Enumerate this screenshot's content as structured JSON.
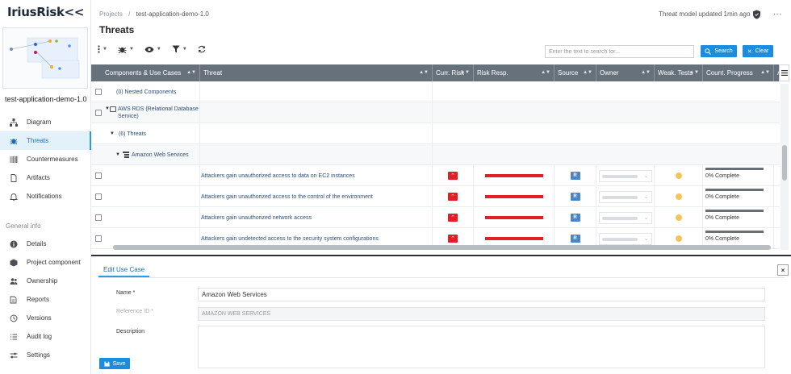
{
  "app": {
    "logo_text": "IriusRisk"
  },
  "project": {
    "name": "test-application-demo-1.0"
  },
  "breadcrumb": {
    "root": "Projects",
    "separator": "/",
    "current": "test-application-demo-1.0"
  },
  "header": {
    "status": "Threat model updated 1min ago",
    "more": "...",
    "page_title": "Threats"
  },
  "sidebar": {
    "items": [
      {
        "label": "Diagram",
        "icon": "sitemap-icon"
      },
      {
        "label": "Threats",
        "icon": "bug-icon",
        "active": true
      },
      {
        "label": "Countermeasures",
        "icon": "barcode-icon"
      },
      {
        "label": "Artifacts",
        "icon": "file-icon"
      },
      {
        "label": "Notifications",
        "icon": "bell-icon"
      }
    ],
    "section_label": "General info",
    "general_items": [
      {
        "label": "Details",
        "icon": "info-icon"
      },
      {
        "label": "Project component",
        "icon": "cube-icon"
      },
      {
        "label": "Ownership",
        "icon": "users-icon"
      },
      {
        "label": "Reports",
        "icon": "reports-icon"
      },
      {
        "label": "Versions",
        "icon": "history-icon"
      },
      {
        "label": "Audit log",
        "icon": "list-icon"
      },
      {
        "label": "Settings",
        "icon": "sliders-icon"
      }
    ]
  },
  "search": {
    "placeholder": "Enter the text to search for...",
    "search_label": "Search",
    "clear_label": "Clear"
  },
  "table": {
    "columns": [
      "Components & Use Cases",
      "Threat",
      "Curr. Risk",
      "Risk Resp.",
      "Source",
      "Owner",
      "Weak. Tests",
      "Count. Progress",
      "A"
    ],
    "group_rows": [
      {
        "label": "(0) Nested Components"
      },
      {
        "label": "AWS RDS (Relational Database Service)"
      },
      {
        "label": "(6) Threats"
      },
      {
        "label": "Amazon Web Services"
      }
    ],
    "threats": [
      {
        "threat": "Attackers gain unauthorized access to data on EC2 instances",
        "source": "R",
        "progress": "0% Complete"
      },
      {
        "threat": "Attackers gain unauthorized access to the control of the environment",
        "source": "R",
        "progress": "0% Complete"
      },
      {
        "threat": "Attackers gain unauthorized network access",
        "source": "R",
        "progress": "0% Complete"
      },
      {
        "threat": "Attackers gain undetected access to the security system configurations",
        "source": "R",
        "progress": "0% Complete"
      }
    ],
    "colors": {
      "header_bg": "#67717c",
      "risk_red": "#e31e24",
      "test_yellow": "#f5c35a",
      "source_blue": "#4a86c7"
    }
  },
  "edit_panel": {
    "tab_label": "Edit Use Case",
    "name_label": "Name *",
    "name_value": "Amazon Web Services",
    "ref_label": "Reference ID *",
    "ref_value": "AMAZON WEB SERVICES",
    "desc_label": "Description",
    "save_label": "Save",
    "close_label": "×"
  }
}
